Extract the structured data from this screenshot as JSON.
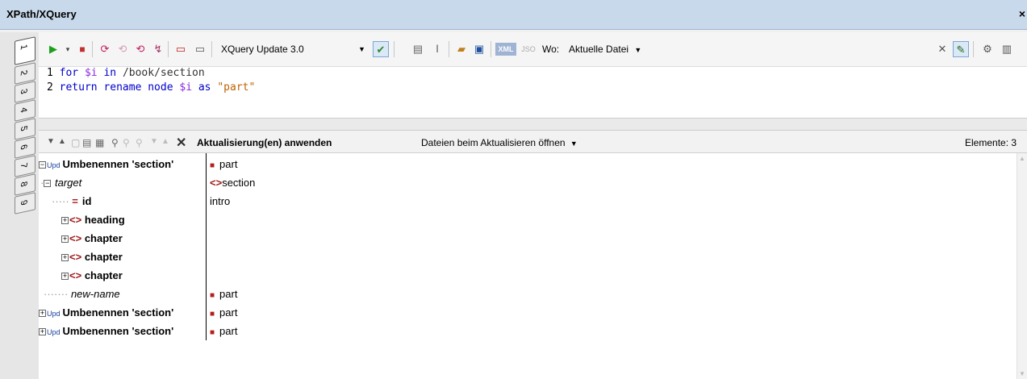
{
  "window": {
    "title": "XPath/XQuery",
    "close_glyph": "×"
  },
  "vtabs": [
    "1",
    "2",
    "3",
    "4",
    "5",
    "6",
    "7",
    "8",
    "9"
  ],
  "toolbar": {
    "language_value": "XQuery Update 3.0",
    "xml_label": "XML",
    "json_label": "JSO",
    "where_label": "Wo:",
    "where_value": "Aktuelle Datei"
  },
  "editor": {
    "lines": [
      {
        "num": "1",
        "t1": "for",
        "t2": "$i",
        "t3": "in",
        "t4": "/book/section",
        "t5": ""
      },
      {
        "num": "2",
        "t1": "return rename node",
        "t2": "$i",
        "t3": "as",
        "t4": "",
        "t5": "\"part\""
      }
    ]
  },
  "results_toolbar": {
    "apply_label": "Aktualisierung(en) anwenden",
    "open_files_label": "Dateien beim Aktualisieren öffnen",
    "elements_label": "Elemente: 3"
  },
  "results": {
    "upd": "Upd",
    "rows": [
      {
        "name": "Umbenennen 'section'",
        "value": "part"
      },
      {
        "name": "target",
        "value": "section"
      },
      {
        "name": "id",
        "value": "intro"
      },
      {
        "name": "heading",
        "value": ""
      },
      {
        "name": "chapter",
        "value": ""
      },
      {
        "name": "chapter",
        "value": ""
      },
      {
        "name": "chapter",
        "value": ""
      },
      {
        "name": "new-name",
        "value": "part"
      },
      {
        "name": "Umbenennen 'section'",
        "value": "part"
      },
      {
        "name": "Umbenennen 'section'",
        "value": "part"
      }
    ]
  }
}
